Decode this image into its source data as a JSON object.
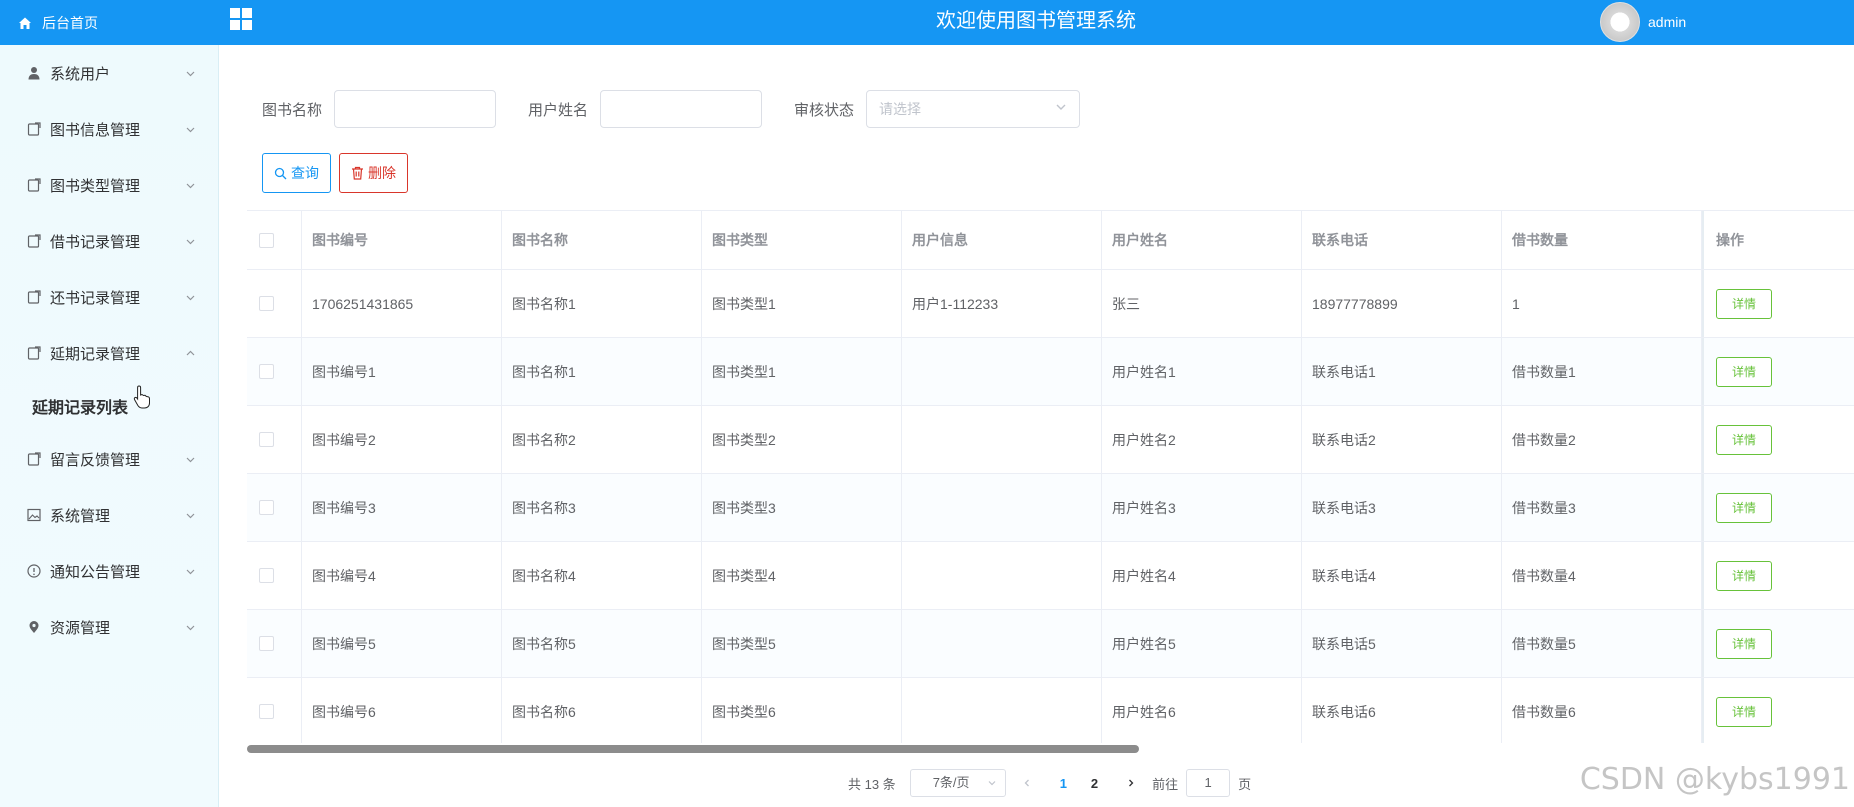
{
  "header": {
    "title": "欢迎使用图书管理系统",
    "user_name": "admin"
  },
  "sidebar": {
    "home_label": "后台首页",
    "items": [
      {
        "label": "系统用户",
        "icon": "user-icon",
        "expanded": false
      },
      {
        "label": "图书信息管理",
        "icon": "document-icon",
        "expanded": false
      },
      {
        "label": "图书类型管理",
        "icon": "document-icon",
        "expanded": false
      },
      {
        "label": "借书记录管理",
        "icon": "document-icon",
        "expanded": false
      },
      {
        "label": "还书记录管理",
        "icon": "document-icon",
        "expanded": false
      },
      {
        "label": "延期记录管理",
        "icon": "document-icon",
        "expanded": true
      },
      {
        "label": "留言反馈管理",
        "icon": "document-icon",
        "expanded": false
      },
      {
        "label": "系统管理",
        "icon": "picture-icon",
        "expanded": false
      },
      {
        "label": "通知公告管理",
        "icon": "info-icon",
        "expanded": false
      },
      {
        "label": "资源管理",
        "icon": "location-icon",
        "expanded": false
      }
    ],
    "submenu_active": "延期记录列表"
  },
  "search": {
    "book_name_label": "图书名称",
    "book_name_value": "",
    "user_name_label": "用户姓名",
    "user_name_value": "",
    "status_label": "审核状态",
    "status_placeholder": "请选择"
  },
  "actions": {
    "query_label": "查询",
    "delete_label": "删除"
  },
  "table": {
    "columns": [
      "图书编号",
      "图书名称",
      "图书类型",
      "用户信息",
      "用户姓名",
      "联系电话",
      "借书数量",
      "操作"
    ],
    "detail_label": "详情",
    "rows": [
      [
        "1706251431865",
        "图书名称1",
        "图书类型1",
        "用户1-112233",
        "张三",
        "18977778899",
        "1"
      ],
      [
        "图书编号1",
        "图书名称1",
        "图书类型1",
        "",
        "用户姓名1",
        "联系电话1",
        "借书数量1"
      ],
      [
        "图书编号2",
        "图书名称2",
        "图书类型2",
        "",
        "用户姓名2",
        "联系电话2",
        "借书数量2"
      ],
      [
        "图书编号3",
        "图书名称3",
        "图书类型3",
        "",
        "用户姓名3",
        "联系电话3",
        "借书数量3"
      ],
      [
        "图书编号4",
        "图书名称4",
        "图书类型4",
        "",
        "用户姓名4",
        "联系电话4",
        "借书数量4"
      ],
      [
        "图书编号5",
        "图书名称5",
        "图书类型5",
        "",
        "用户姓名5",
        "联系电话5",
        "借书数量5"
      ],
      [
        "图书编号6",
        "图书名称6",
        "图书类型6",
        "",
        "用户姓名6",
        "联系电话6",
        "借书数量6"
      ]
    ]
  },
  "pagination": {
    "total_text": "共 13 条",
    "page_size": "7条/页",
    "pages": [
      "1",
      "2"
    ],
    "current_page": "1",
    "goto_prefix": "前往",
    "goto_value": "1",
    "goto_suffix": "页"
  },
  "watermark": "CSDN @kybs1991",
  "colors": {
    "primary": "#1596f3",
    "danger": "#d9362b",
    "success": "#67c23a",
    "sidebar_bg": "#eefafd"
  }
}
